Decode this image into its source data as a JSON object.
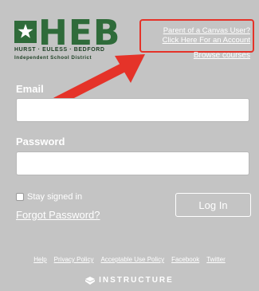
{
  "header": {
    "logo": {
      "main": "HEB",
      "sub_line1": "HURST · EULESS · BEDFORD",
      "sub_line2": "Independent School District"
    },
    "parent_link": "Parent of a Canvas User?",
    "click_here_link": "Click Here For an Account",
    "browse_courses": "Browse courses"
  },
  "form": {
    "email_label": "Email",
    "email_value": "",
    "password_label": "Password",
    "password_value": "",
    "stay_signed_in": "Stay signed in",
    "stay_signed_in_checked": false,
    "forgot_password": "Forgot Password?",
    "login_button": "Log In"
  },
  "footer": {
    "links": [
      "Help",
      "Privacy Policy",
      "Acceptable Use Policy",
      "Facebook",
      "Twitter"
    ],
    "brand": "INSTRUCTURE"
  },
  "colors": {
    "background": "#c4c4c4",
    "logo_green": "#2f6b3a",
    "callout_red": "#e53329"
  }
}
